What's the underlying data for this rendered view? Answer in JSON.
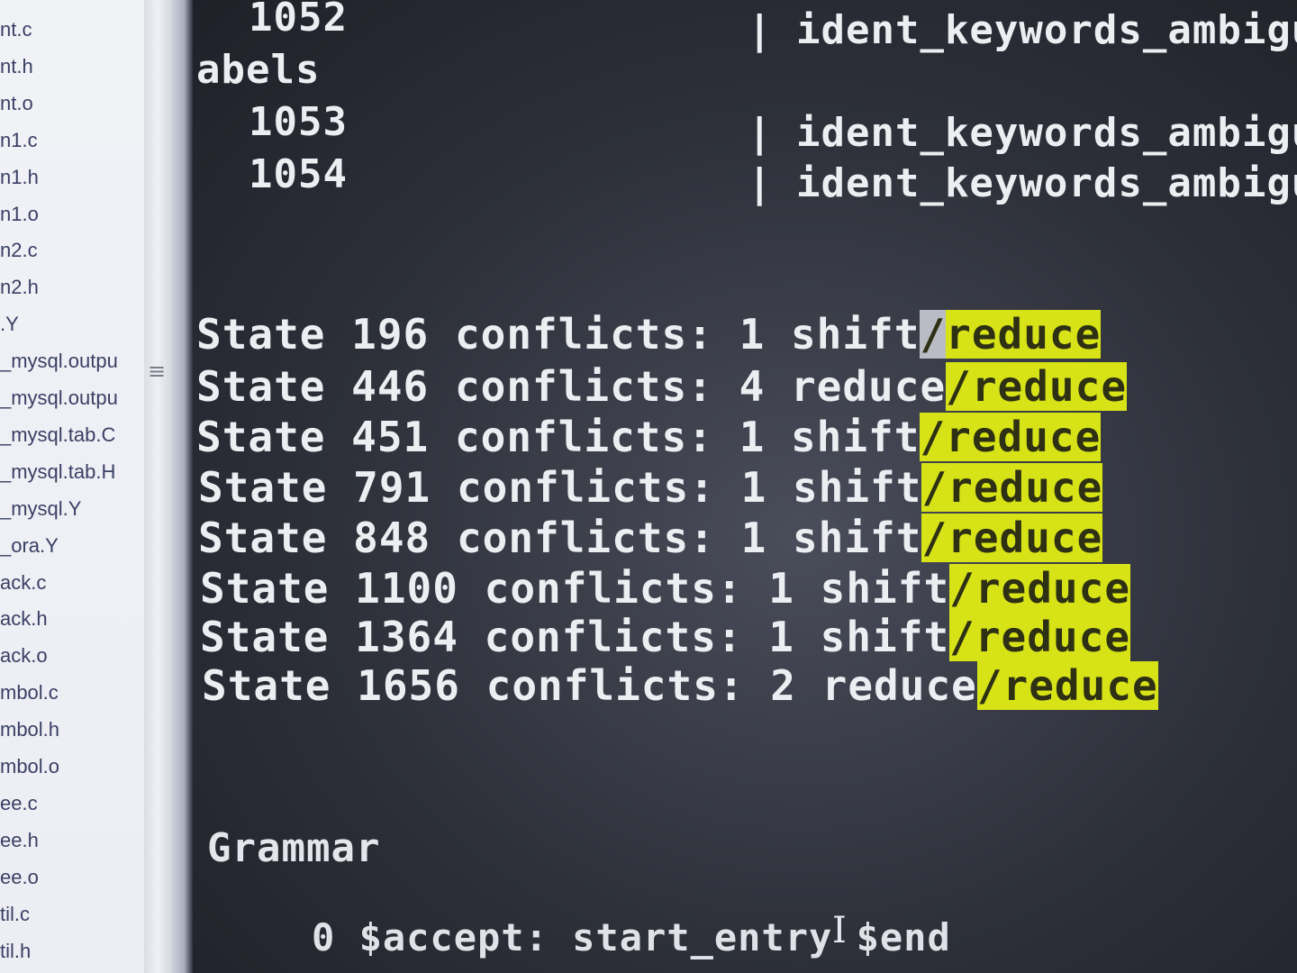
{
  "file_list": [
    "nt.c",
    "nt.h",
    "nt.o",
    "n1.c",
    "n1.h",
    "n1.o",
    "n2.c",
    "n2.h",
    ".Y",
    "_mysql.outpu",
    "_mysql.outpu",
    "_mysql.tab.C",
    "_mysql.tab.H",
    "_mysql.Y",
    "_ora.Y",
    "ack.c",
    "ack.h",
    "ack.o",
    "mbol.c",
    "mbol.h",
    "mbol.o",
    "ee.c",
    "ee.h",
    "ee.o",
    "til.c",
    "til.h"
  ],
  "splitter_glyph": "≡",
  "terminal": {
    "top_lines": [
      {
        "number": "1052",
        "pipe": "|",
        "text": "ident_keywords_ambigu"
      },
      {
        "label": "abels"
      },
      {
        "number": "1053",
        "pipe": "|",
        "text": "ident_keywords_ambigu"
      },
      {
        "number": "1054",
        "pipe": "|",
        "text": "ident_keywords_ambigu"
      }
    ],
    "conflicts": [
      {
        "prefix": "State 196 conflicts: 1 shift",
        "slash": "/",
        "match": "reduce"
      },
      {
        "prefix": "State 446 conflicts: 4 reduce",
        "slash": "/",
        "match": "reduce"
      },
      {
        "prefix": "State 451 conflicts: 1 shift",
        "slash": "/",
        "match": "reduce"
      },
      {
        "prefix": "State 791 conflicts: 1 shift",
        "slash": "/",
        "match": "reduce"
      },
      {
        "prefix": "State 848 conflicts: 1 shift",
        "slash": "/",
        "match": "reduce"
      },
      {
        "prefix": "State 1100 conflicts: 1 shift",
        "slash": "/",
        "match": "reduce"
      },
      {
        "prefix": "State 1364 conflicts: 1 shift",
        "slash": "/",
        "match": "reduce"
      },
      {
        "prefix": "State 1656 conflicts: 2 reduce",
        "slash": "/",
        "match": "reduce"
      }
    ],
    "grammar_heading": "Grammar",
    "grammar_rule": "0 $accept: start_entry $end",
    "cursor": "I"
  },
  "colors": {
    "highlight": "#d7e317",
    "terminal_bg": "#2d3039",
    "text": "#eceef2"
  }
}
